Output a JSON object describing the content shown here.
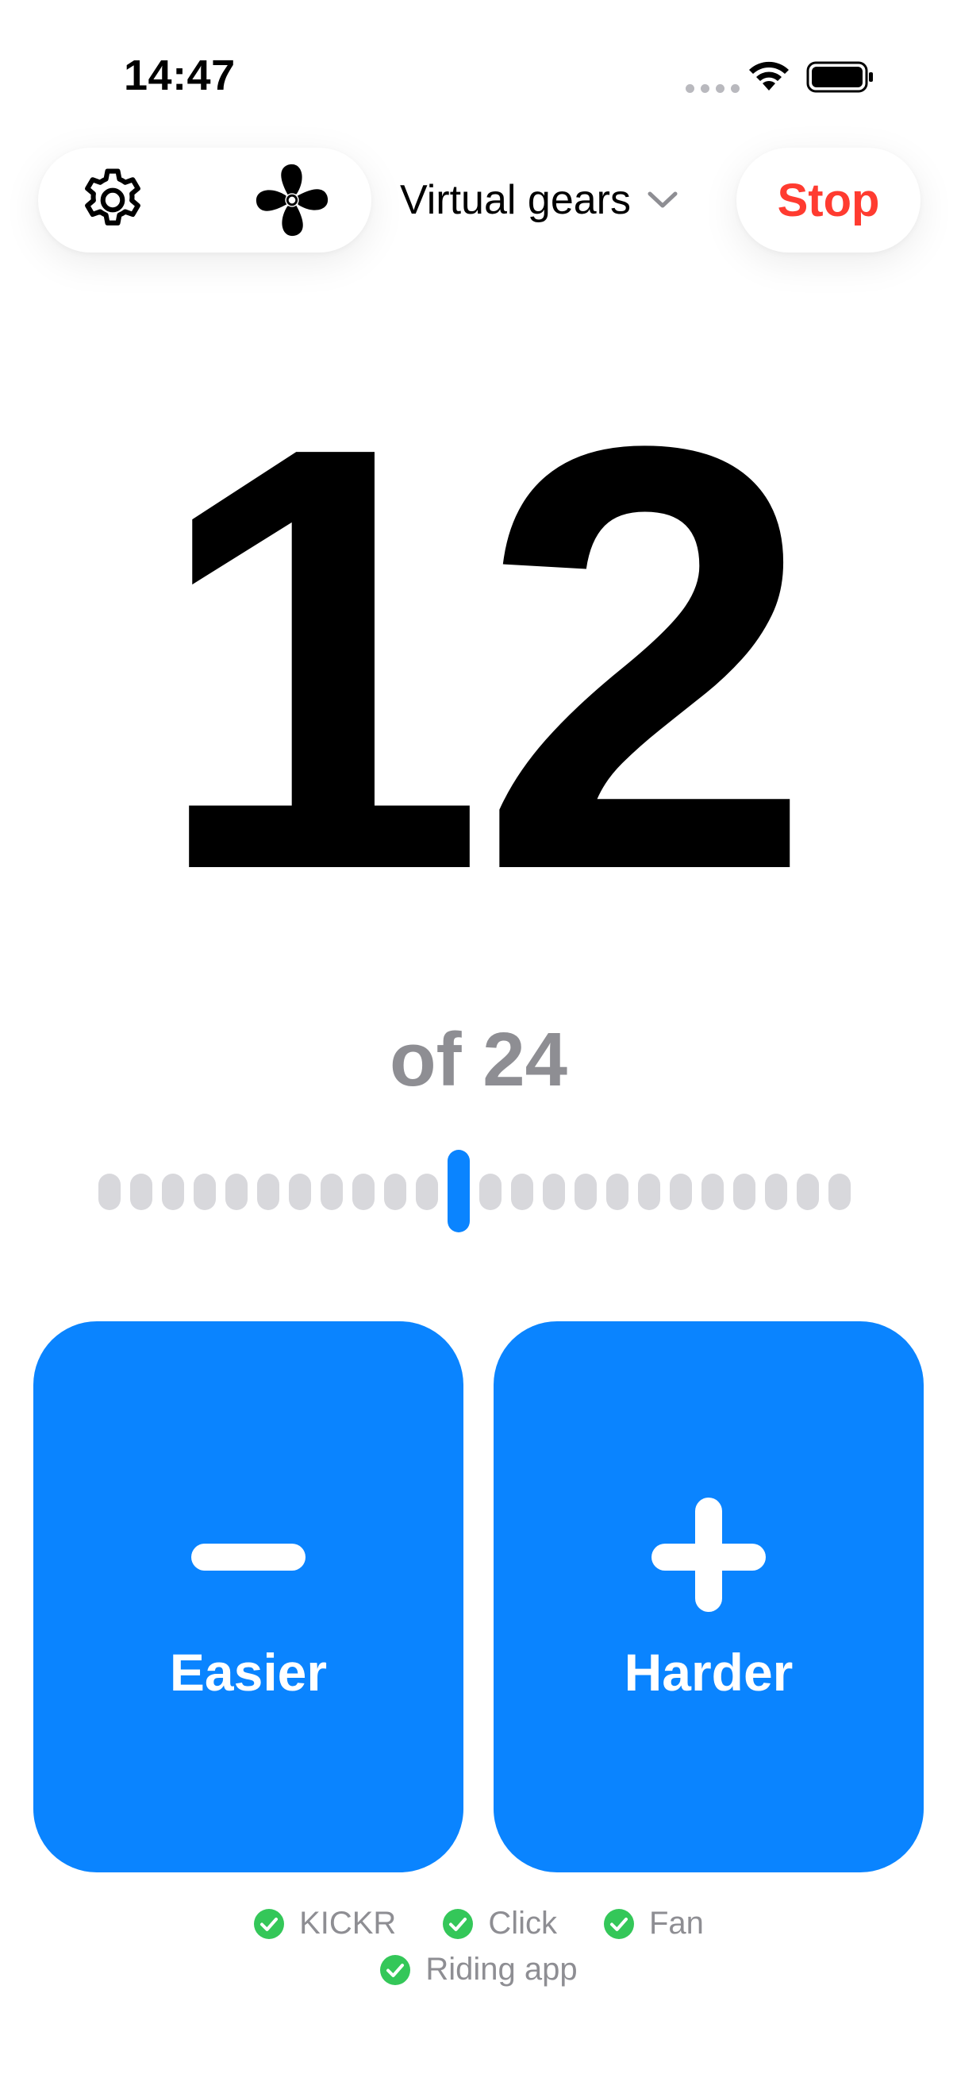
{
  "status_bar": {
    "time": "14:47",
    "icons": [
      "signal-dots-icon",
      "wifi-icon",
      "battery-icon"
    ]
  },
  "toolbar": {
    "settings_icon": "gear-icon",
    "fan_icon": "fan-icon",
    "mode_label": "Virtual gears",
    "mode_icon": "chevron-down-icon",
    "stop_label": "Stop"
  },
  "gear": {
    "current": "12",
    "total_label": "of 24",
    "current_value": 12,
    "total_value": 24
  },
  "controls": {
    "easier_label": "Easier",
    "easier_icon": "minus-icon",
    "harder_label": "Harder",
    "harder_icon": "plus-icon"
  },
  "connections": [
    {
      "label": "KICKR",
      "icon": "check-circle-icon"
    },
    {
      "label": "Click",
      "icon": "check-circle-icon"
    },
    {
      "label": "Fan",
      "icon": "check-circle-icon"
    },
    {
      "label": "Riding app",
      "icon": "check-circle-icon"
    }
  ],
  "colors": {
    "accent": "#0a84ff",
    "stop": "#ff3b30",
    "muted_text": "#8e8e93",
    "inactive_segment": "#d8d8dc",
    "success": "#34c759"
  }
}
